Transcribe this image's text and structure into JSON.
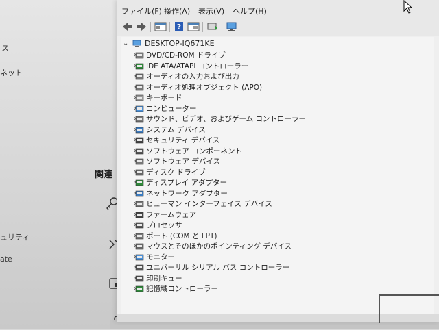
{
  "background": {
    "left_fragments": [
      "ス",
      "ネット",
      "ュリティ",
      "ate"
    ],
    "related_heading": "関連",
    "icons": [
      "key-icon",
      "share-icon",
      "window-icon",
      "lock-icon"
    ]
  },
  "menu": {
    "file": "ファイル(F)",
    "action": "操作(A)",
    "view": "表示(V)",
    "help": "ヘルプ(H)"
  },
  "toolbar": {
    "buttons": [
      "back-icon",
      "forward-icon",
      "properties-window-icon",
      "help-icon",
      "show-hide-pane-icon",
      "update-driver-icon",
      "scan-hardware-icon"
    ]
  },
  "tree": {
    "root": "DESKTOP-IQ671KE",
    "items": [
      {
        "label": "DVD/CD-ROM ドライブ",
        "icon": "dvd-icon"
      },
      {
        "label": "IDE ATA/ATAPI コントローラー",
        "icon": "ide-controller-icon"
      },
      {
        "label": "オーディオの入力および出力",
        "icon": "audio-io-icon"
      },
      {
        "label": "オーディオ処理オブジェクト (APO)",
        "icon": "audio-apo-icon"
      },
      {
        "label": "キーボード",
        "icon": "keyboard-icon"
      },
      {
        "label": "コンピューター",
        "icon": "computer-icon"
      },
      {
        "label": "サウンド、ビデオ、およびゲーム コントローラー",
        "icon": "sound-icon"
      },
      {
        "label": "システム デバイス",
        "icon": "system-device-icon"
      },
      {
        "label": "セキュリティ デバイス",
        "icon": "security-device-icon"
      },
      {
        "label": "ソフトウェア コンポーネント",
        "icon": "software-component-icon"
      },
      {
        "label": "ソフトウェア デバイス",
        "icon": "software-device-icon"
      },
      {
        "label": "ディスク ドライブ",
        "icon": "disk-drive-icon"
      },
      {
        "label": "ディスプレイ アダプター",
        "icon": "display-adapter-icon"
      },
      {
        "label": "ネットワーク アダプター",
        "icon": "network-adapter-icon"
      },
      {
        "label": "ヒューマン インターフェイス デバイス",
        "icon": "hid-icon"
      },
      {
        "label": "ファームウェア",
        "icon": "firmware-icon"
      },
      {
        "label": "プロセッサ",
        "icon": "processor-icon"
      },
      {
        "label": "ポート (COM と LPT)",
        "icon": "port-icon"
      },
      {
        "label": "マウスとそのほかのポインティング デバイス",
        "icon": "mouse-icon"
      },
      {
        "label": "モニター",
        "icon": "monitor-icon"
      },
      {
        "label": "ユニバーサル シリアル バス コントローラー",
        "icon": "usb-icon"
      },
      {
        "label": "印刷キュー",
        "icon": "print-queue-icon"
      },
      {
        "label": "記憶域コントローラー",
        "icon": "storage-controller-icon"
      }
    ]
  },
  "colors": {
    "window_bg": "#efefef",
    "menubar_bg": "#e8e8e8",
    "accent_blue": "#2a7fd4"
  }
}
